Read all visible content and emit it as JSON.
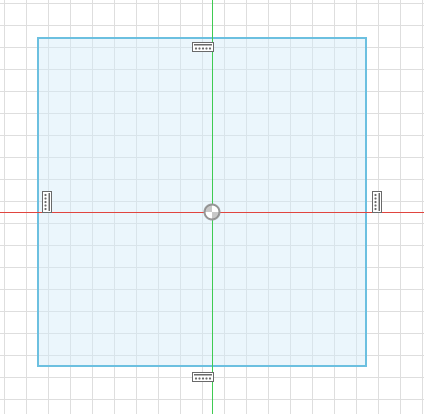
{
  "viewport": {
    "description_label": "",
    "grid_color": "#dedede",
    "background_color": "#ffffff"
  },
  "sketch": {
    "shape": "rectangle",
    "edge_color": "#6cc0e0",
    "fill_color": "#d2eaf8",
    "selected": true
  },
  "axes": {
    "x_axis_color": "#e0453f",
    "y_axis_color": "#3fcb52"
  },
  "origin": {
    "icon": "origin-point-icon"
  },
  "constraints": [
    {
      "side": "top",
      "icon": "horizontal-constraint-icon"
    },
    {
      "side": "bottom",
      "icon": "horizontal-constraint-icon"
    },
    {
      "side": "left",
      "icon": "vertical-constraint-icon"
    },
    {
      "side": "right",
      "icon": "vertical-constraint-icon"
    }
  ]
}
